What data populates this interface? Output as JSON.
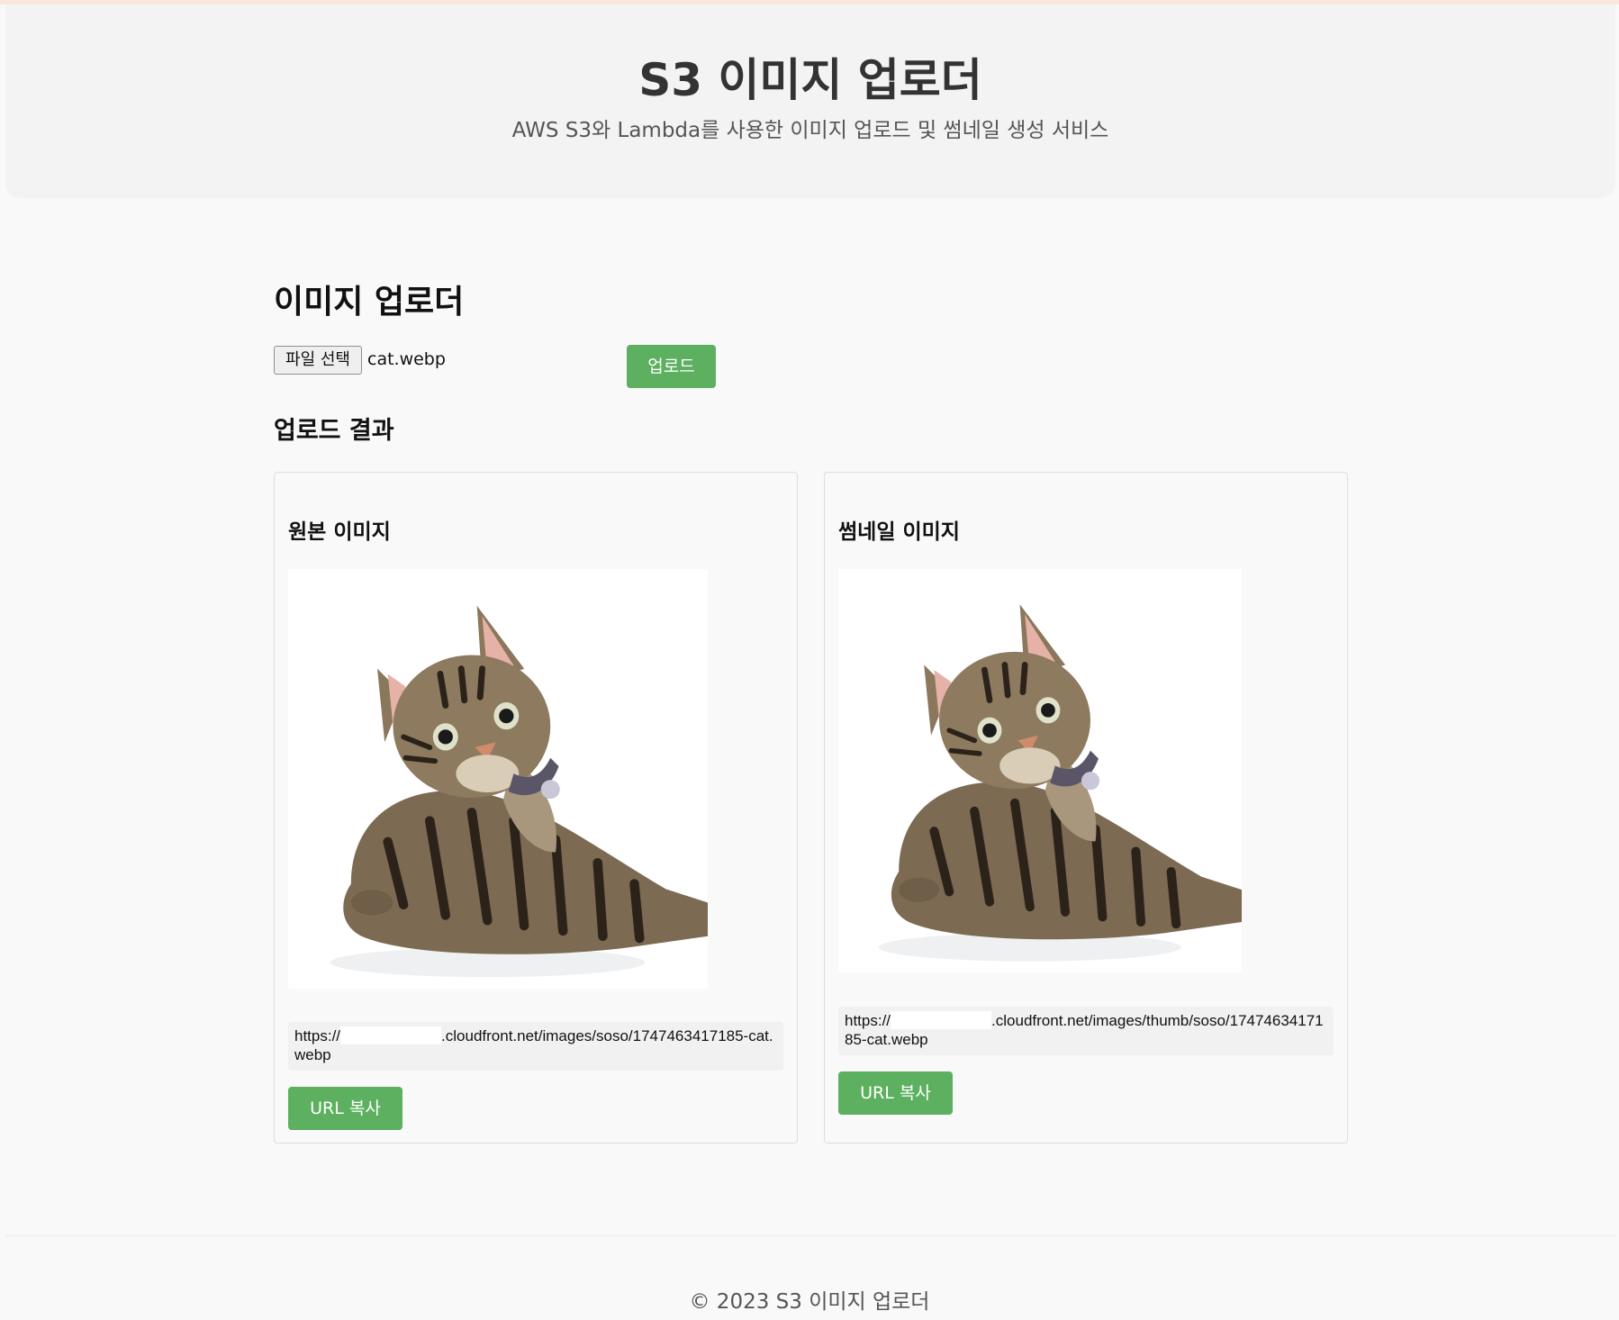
{
  "header": {
    "title": "S3 이미지 업로더",
    "subtitle": "AWS S3와 Lambda를 사용한 이미지 업로드 및 썸네일 생성 서비스"
  },
  "uploader": {
    "title": "이미지 업로더",
    "file_button_label": "파일 선택",
    "file_name": "cat.webp",
    "upload_label": "업로드"
  },
  "results": {
    "title": "업로드 결과",
    "original": {
      "title": "원본 이미지",
      "url_prefix": "https://",
      "url_suffix": ".cloudfront.net/images/soso/1747463417185-cat.webp",
      "copy_label": "URL 복사"
    },
    "thumbnail": {
      "title": "썸네일 이미지",
      "url_prefix": "https://",
      "url_suffix": ".cloudfront.net/images/thumb/soso/1747463417185-cat.webp",
      "copy_label": "URL 복사"
    }
  },
  "footer": {
    "text": "© 2023 S3 이미지 업로더"
  },
  "colors": {
    "button_green": "#5cb05f",
    "header_bg": "#f3f3f3",
    "page_bg": "#f9f9f9"
  }
}
